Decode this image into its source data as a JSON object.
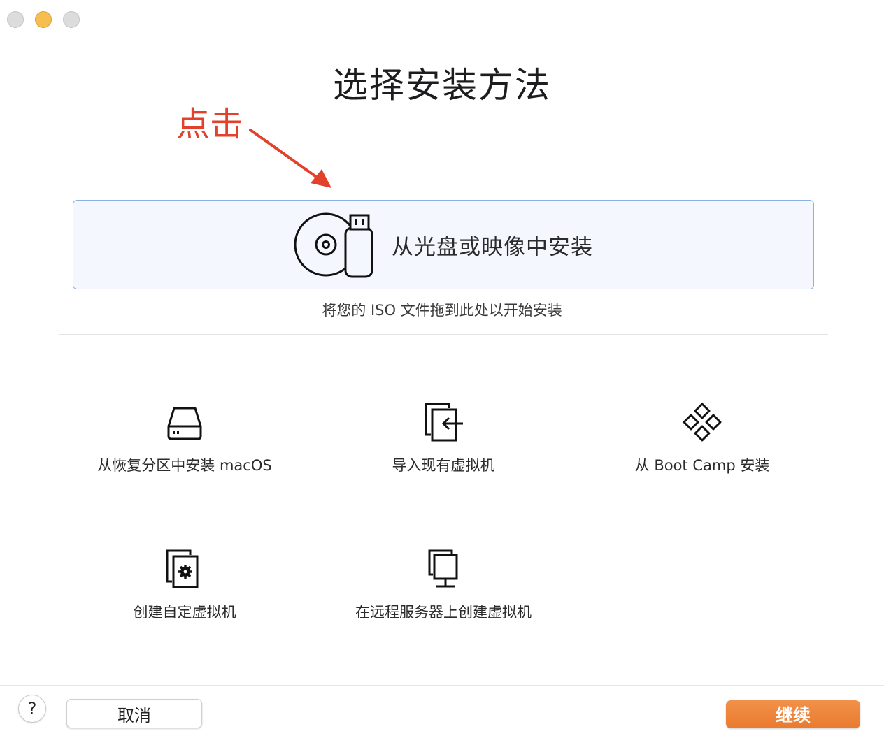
{
  "window": {
    "controls": [
      "close",
      "minimize",
      "zoom"
    ]
  },
  "title": "选择安装方法",
  "annotation": {
    "text": "点击",
    "color": "#e2412b"
  },
  "primary_option": {
    "label": "从光盘或映像中安装",
    "icon": "disc-usb-icon"
  },
  "hint": "将您的 ISO 文件拖到此处以开始安装",
  "options": [
    {
      "label": "从恢复分区中安装 macOS",
      "icon": "hard-drive-icon"
    },
    {
      "label": "导入现有虚拟机",
      "icon": "import-vm-icon"
    },
    {
      "label": "从 Boot Camp 安装",
      "icon": "bootcamp-icon"
    },
    {
      "label": "创建自定虚拟机",
      "icon": "custom-vm-icon"
    },
    {
      "label": "在远程服务器上创建虚拟机",
      "icon": "remote-server-icon"
    }
  ],
  "footer": {
    "help_label": "?",
    "cancel_label": "取消",
    "continue_label": "继续",
    "accent": "#ec8034"
  }
}
